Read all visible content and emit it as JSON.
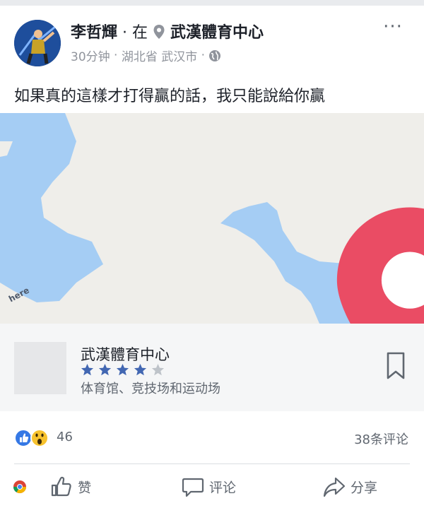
{
  "post": {
    "author": "李哲輝",
    "separator": "·",
    "at_label": "在",
    "place": "武漢體育中心",
    "time": "30分钟",
    "dot1": "·",
    "location": "湖北省 武汉市",
    "dot2": "·",
    "privacy_icon": "globe-icon",
    "more_label": "···",
    "text": "如果真的這樣才打得贏的話，我只能說給你贏"
  },
  "map": {
    "attribution": "here",
    "water_color": "#a5cdf4",
    "land_color": "#efeeea",
    "pin_color": "#ea4c64"
  },
  "place_card": {
    "name": "武漢體育中心",
    "rating": 4,
    "max_rating": 5,
    "category": "体育馆、竞技场和运动场",
    "bookmark_icon": "bookmark-icon"
  },
  "reactions": {
    "icons": [
      "like-reaction-icon",
      "wow-reaction-icon"
    ],
    "count": "46",
    "comments": "38条评论"
  },
  "actions": {
    "like": "赞",
    "comment": "评论",
    "share": "分享"
  },
  "colors": {
    "accent_blue": "#3578e5",
    "star_blue": "#4267b2",
    "text_secondary": "#606770"
  }
}
